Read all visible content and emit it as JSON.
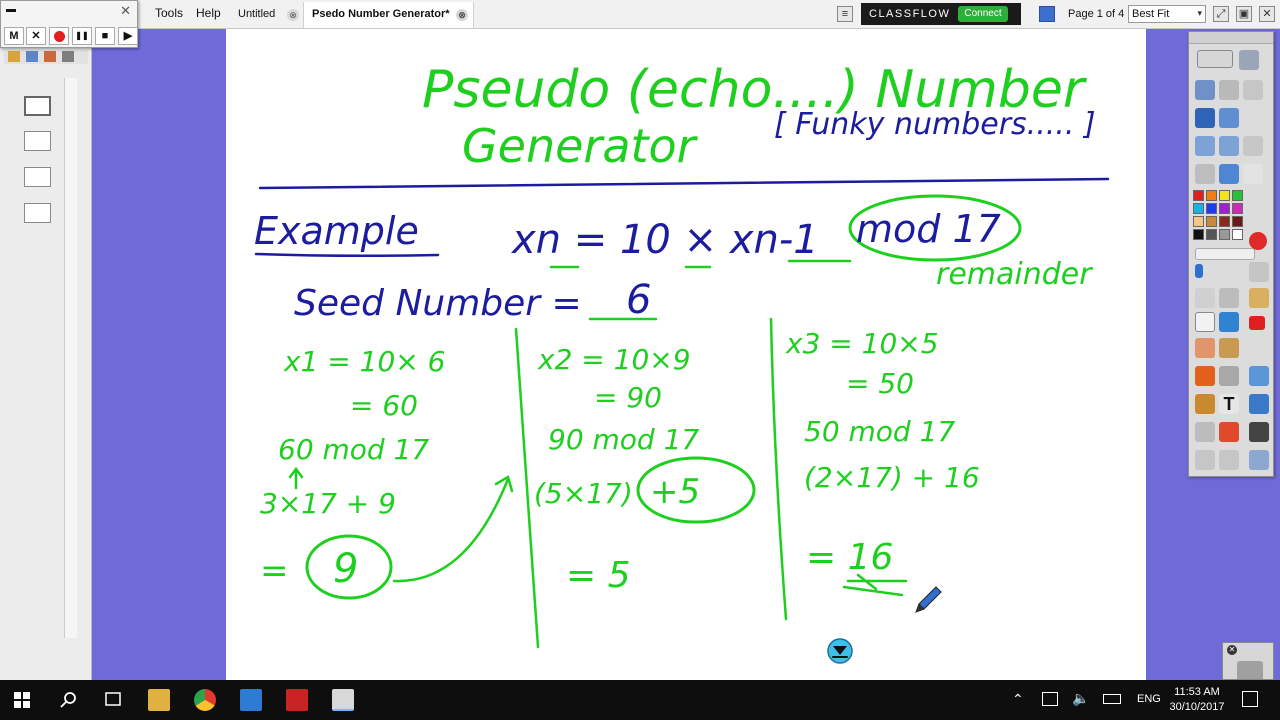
{
  "menubar": {
    "menu_tools": "Tools",
    "menu_help": "Help",
    "menu_partial": "t",
    "tabs": [
      {
        "label": "Untitled"
      },
      {
        "label": "Psedo Number Generator*"
      }
    ],
    "tab_close_glyph": "⊗",
    "classflow_label": "CLASSFLOW",
    "connect_label": "Connect",
    "page_indicator": "Page 1 of 4",
    "zoom_value": "Best Fit",
    "zoom_arrow": "▾"
  },
  "recorder": {
    "close_glyph": "✕",
    "buttons": [
      "M",
      "✕",
      "",
      "❚❚",
      "■",
      "▶"
    ]
  },
  "flipchart": {
    "title_line1": "Pseudo (echo....) Number",
    "title_line2": "Generator",
    "subtitle": "[ Funky numbers..... ]",
    "example_label": "Example",
    "formula": "xn = 10 × xn-1",
    "formula_mod": "mod 17",
    "remainder_note": "remainder",
    "seed_label": "Seed Number = ",
    "seed_value": "6",
    "col1": [
      "x1 = 10× 6",
      "= 60",
      "60 mod 17",
      "3×17 + 9",
      "="
    ],
    "col1_result": "9",
    "col2": [
      "x2 = 10×9",
      "= 90",
      "90 mod 17",
      "(5×17)"
    ],
    "col2_circled": "+5",
    "col2_result": "= 5",
    "col3": [
      "x3 = 10×5",
      "= 50",
      "50 mod 17",
      "(2×17) + 16",
      "= 16"
    ]
  },
  "taskbar": {
    "lang": "ENG",
    "time": "11:53 AM",
    "date": "30/10/2017"
  },
  "colors": {
    "ink_green": "#1fcf1f",
    "ink_blue": "#1c1c9e",
    "background_purple": "#6f6ad8",
    "connect_green": "#2fae3c"
  }
}
